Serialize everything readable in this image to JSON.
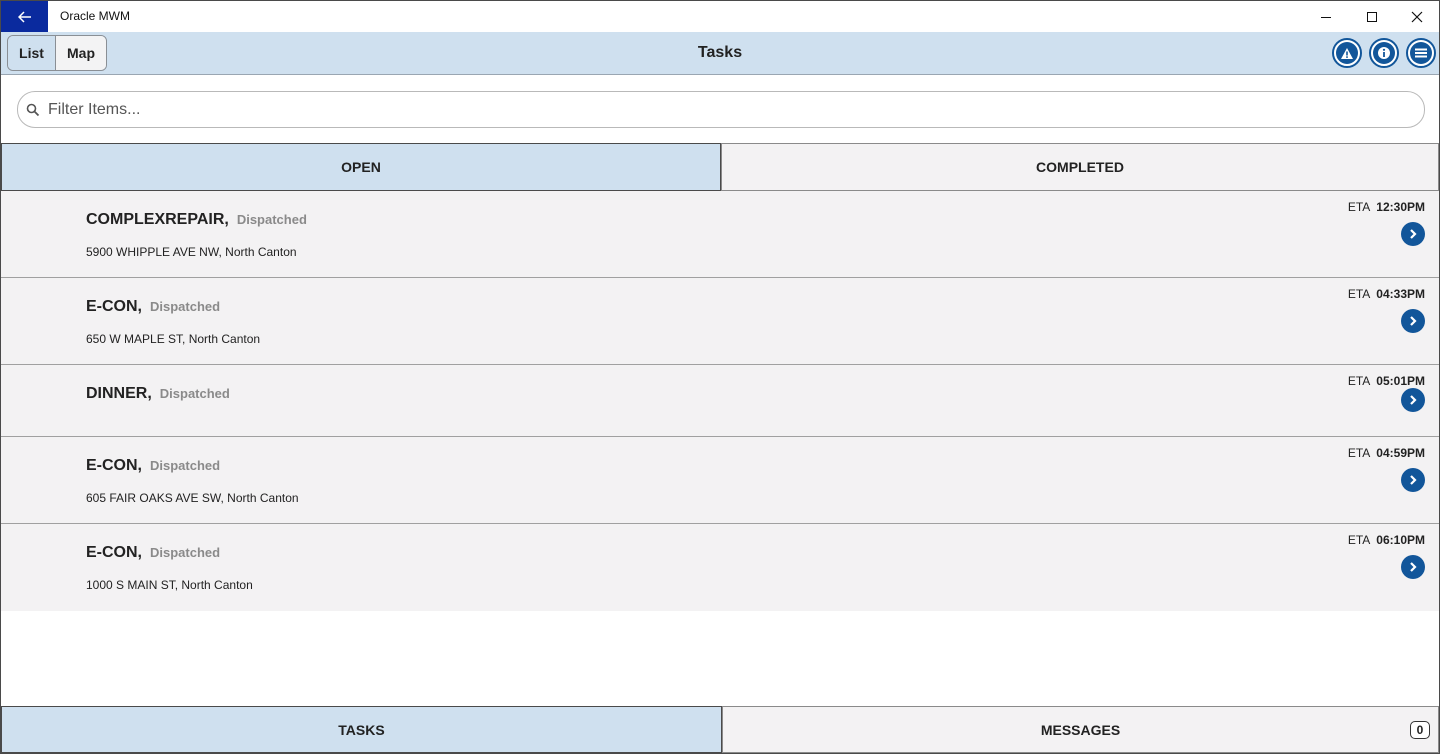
{
  "window": {
    "title": "Oracle MWM"
  },
  "header": {
    "title": "Tasks",
    "view_toggle": {
      "list_label": "List",
      "map_label": "Map",
      "selected": "List"
    },
    "icons": [
      "alert-icon",
      "info-icon",
      "menu-icon"
    ]
  },
  "search": {
    "placeholder": "Filter Items...",
    "value": ""
  },
  "tabs": [
    {
      "label": "OPEN",
      "selected": true
    },
    {
      "label": "COMPLETED",
      "selected": false
    }
  ],
  "tasks": [
    {
      "type": "COMPLEXREPAIR,",
      "status": "Dispatched",
      "address": "5900 WHIPPLE AVE NW, North Canton",
      "eta_label": "ETA",
      "eta": "12:30PM"
    },
    {
      "type": "E-CON,",
      "status": "Dispatched",
      "address": "650 W MAPLE ST, North Canton",
      "eta_label": "ETA",
      "eta": "04:33PM"
    },
    {
      "type": "DINNER,",
      "status": "Dispatched",
      "address": "",
      "eta_label": "ETA",
      "eta": "05:01PM"
    },
    {
      "type": "E-CON,",
      "status": "Dispatched",
      "address": "605 FAIR OAKS AVE SW, North Canton",
      "eta_label": "ETA",
      "eta": "04:59PM"
    },
    {
      "type": "E-CON,",
      "status": "Dispatched",
      "address": "1000 S MAIN ST, North Canton",
      "eta_label": "ETA",
      "eta": "06:10PM"
    }
  ],
  "bottom_nav": {
    "tasks_label": "TASKS",
    "messages_label": "MESSAGES",
    "messages_count": "0"
  },
  "colors": {
    "accent": "#12569a",
    "header_bg": "#cfe0ef",
    "back_button_bg": "#0a2a9e",
    "row_bg": "#f3f2f3"
  }
}
